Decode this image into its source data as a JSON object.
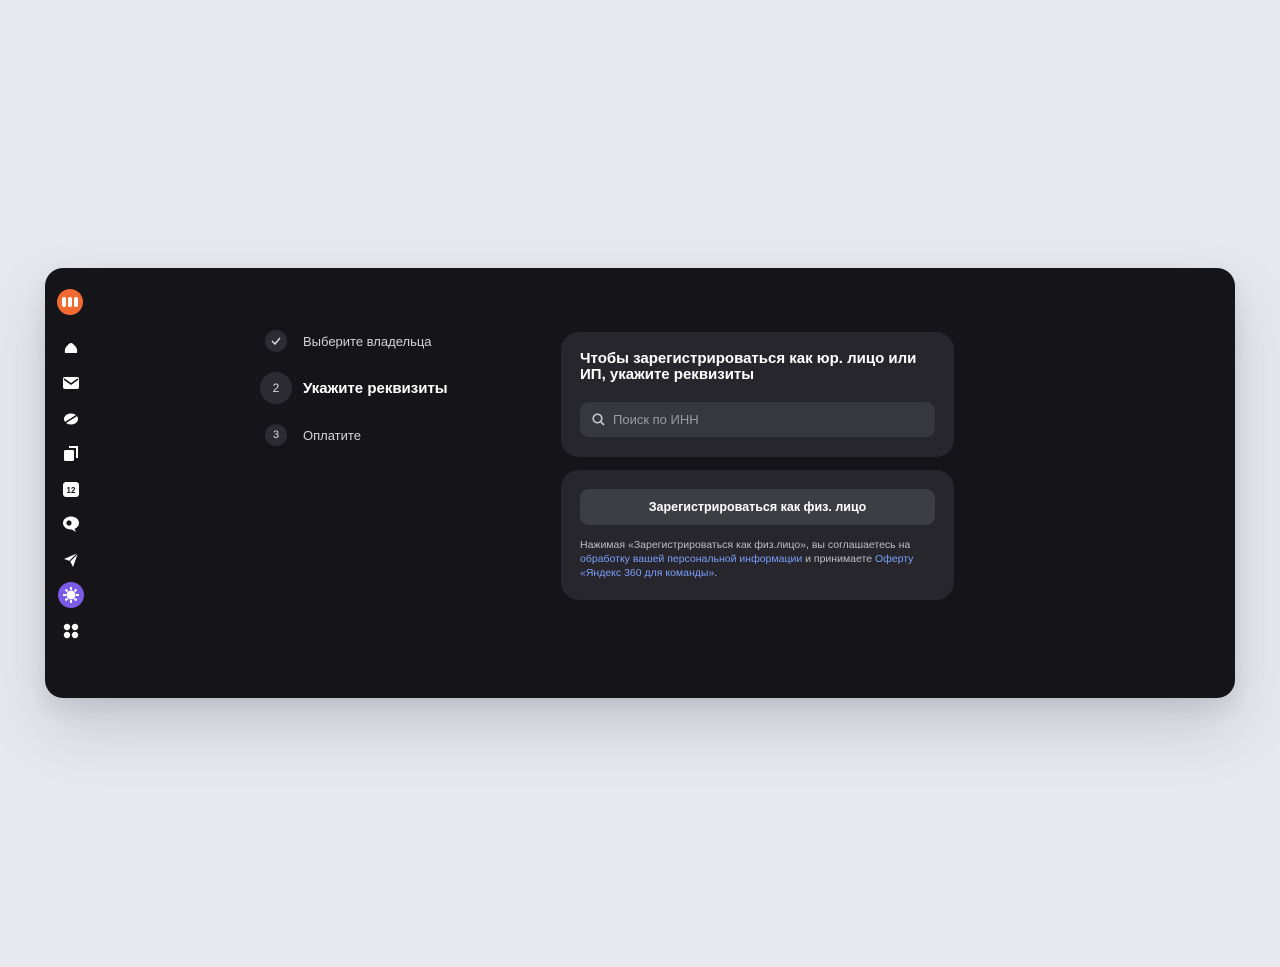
{
  "sidebar": {
    "items": [
      {
        "name": "logo-icon"
      },
      {
        "name": "cloud-disk-icon"
      },
      {
        "name": "mail-icon"
      },
      {
        "name": "messenger-icon"
      },
      {
        "name": "documents-icon"
      },
      {
        "name": "calendar-icon",
        "text": "12"
      },
      {
        "name": "telemost-icon"
      },
      {
        "name": "send-icon"
      },
      {
        "name": "admin-icon"
      },
      {
        "name": "apps-grid-icon"
      }
    ]
  },
  "steps": {
    "step1": {
      "label": "Выберите владельца",
      "status": "done"
    },
    "step2": {
      "number": "2",
      "label": "Укажите реквизиты",
      "status": "active"
    },
    "step3": {
      "number": "3",
      "label": "Оплатите",
      "status": "pending"
    }
  },
  "company_card": {
    "title": "Чтобы зарегистрироваться как юр. лицо или ИП, укажите реквизиты",
    "search_placeholder": "Поиск по ИНН"
  },
  "individual_card": {
    "button_label": "Зарегистрироваться как физ. лицо",
    "legal_text_1": "Нажимая «Зарегистрироваться как физ.лицо», вы соглашаетесь на ",
    "legal_link_1": "обработку вашей персональной информации",
    "legal_text_2": " и принимаете ",
    "legal_link_2": "Оферту «Яндекс 360 для команды»",
    "legal_text_3": "."
  },
  "colors": {
    "background": "#e8e9ee",
    "window": "#151519",
    "card": "#26262c",
    "accent_logo": "#f26a32",
    "accent_admin": "#7b5ce6",
    "link": "#7c9dfa"
  }
}
